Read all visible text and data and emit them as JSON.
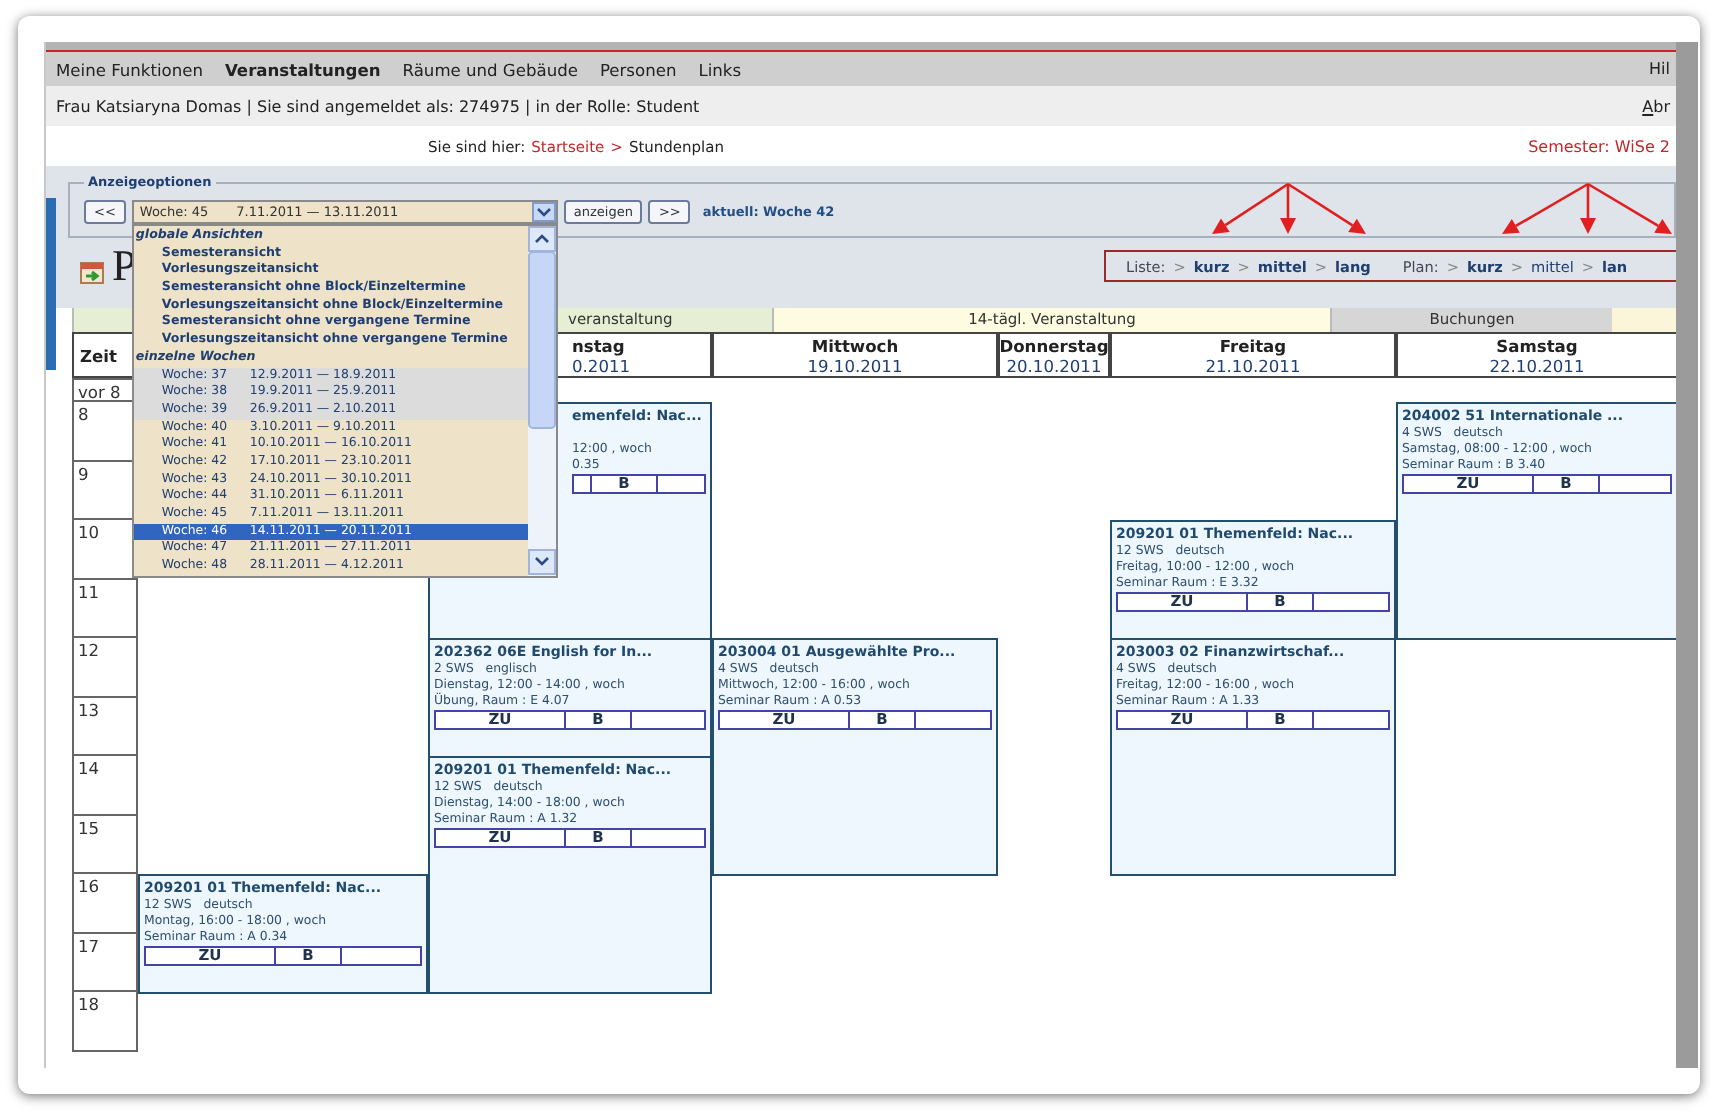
{
  "nav": {
    "items": [
      {
        "label": "Meine Funktionen",
        "selected": false
      },
      {
        "label": "Veranstaltungen",
        "selected": true
      },
      {
        "label": "Räume und Gebäude",
        "selected": false
      },
      {
        "label": "Personen",
        "selected": false
      },
      {
        "label": "Links",
        "selected": false
      }
    ],
    "help": "Hil"
  },
  "user_bar": {
    "text": "Frau Katsiaryna Domas | Sie sind angemeldet als: 274975 | in der Rolle: Student",
    "logout": "Abr"
  },
  "breadcrumb": {
    "prefix": "Sie sind hier:",
    "home": "Startseite",
    "separator": ">",
    "current": "Stundenplan",
    "semester": "Semester: WiSe 2"
  },
  "options": {
    "legend": "Anzeigeoptionen",
    "prev": "<<",
    "show": "anzeigen",
    "next": ">>",
    "current_week": "aktuell: Woche 42",
    "week_select": {
      "week": "Woche: 45",
      "dates": "7.11.2011 — 13.11.2011",
      "expanded": true,
      "groups": [
        {
          "kind": "views",
          "title": "globale Ansichten",
          "options": [
            {
              "label": "Semesteransicht"
            },
            {
              "label": "Vorlesungszeitansicht"
            },
            {
              "label": "Semesteransicht ohne Block/Einzeltermine"
            },
            {
              "label": "Vorlesungszeitansicht ohne Block/Einzeltermine"
            },
            {
              "label": "Semesteransicht ohne vergangene Termine"
            },
            {
              "label": "Vorlesungszeitansicht ohne vergangene Termine"
            }
          ]
        },
        {
          "kind": "weeks",
          "title": "einzelne Wochen",
          "options": [
            {
              "week": "Woche: 37",
              "dates": "12.9.2011 — 18.9.2011",
              "shaded": true,
              "selected": false
            },
            {
              "week": "Woche: 38",
              "dates": "19.9.2011 — 25.9.2011",
              "shaded": true,
              "selected": false
            },
            {
              "week": "Woche: 39",
              "dates": "26.9.2011 — 2.10.2011",
              "shaded": true,
              "selected": false
            },
            {
              "week": "Woche: 40",
              "dates": "3.10.2011 — 9.10.2011",
              "shaded": false,
              "selected": false
            },
            {
              "week": "Woche: 41",
              "dates": "10.10.2011 — 16.10.2011",
              "shaded": false,
              "selected": false
            },
            {
              "week": "Woche: 42",
              "dates": "17.10.2011 — 23.10.2011",
              "shaded": false,
              "selected": false
            },
            {
              "week": "Woche: 43",
              "dates": "24.10.2011 — 30.10.2011",
              "shaded": false,
              "selected": false
            },
            {
              "week": "Woche: 44",
              "dates": "31.10.2011 — 6.11.2011",
              "shaded": false,
              "selected": false
            },
            {
              "week": "Woche: 45",
              "dates": "7.11.2011 — 13.11.2011",
              "shaded": false,
              "selected": false
            },
            {
              "week": "Woche: 46",
              "dates": "14.11.2011 — 20.11.2011",
              "shaded": false,
              "selected": true
            },
            {
              "week": "Woche: 47",
              "dates": "21.11.2011 — 27.11.2011",
              "shaded": false,
              "selected": false
            },
            {
              "week": "Woche: 48",
              "dates": "28.11.2011 — 4.12.2011",
              "shaded": false,
              "selected": false
            }
          ]
        }
      ]
    }
  },
  "page_title": "P",
  "views": [
    {
      "label": "Liste:",
      "separator": ">",
      "links": [
        {
          "label": "kurz",
          "selected": false
        },
        {
          "label": "mittel",
          "selected": false
        },
        {
          "label": "lang",
          "selected": false
        }
      ]
    },
    {
      "label": "Plan:",
      "separator": ">",
      "links": [
        {
          "label": "kurz",
          "selected": false
        },
        {
          "label": "mittel",
          "selected": true
        },
        {
          "label": "lan",
          "selected": false
        }
      ]
    }
  ],
  "legend": [
    {
      "kind": "partial",
      "label": "veranstaltung",
      "color": "#e6eed4"
    },
    {
      "kind": "full",
      "label": "14-tägl. Veranstaltung",
      "color": "#fdfbe0"
    },
    {
      "kind": "full",
      "label": "Buchungen",
      "color": "#d6d6d6"
    }
  ],
  "timetable": {
    "time_header": "Zeit",
    "hours": [
      "vor 8",
      "8",
      "9",
      "10",
      "11",
      "12",
      "13",
      "14",
      "15",
      "16",
      "17",
      "18"
    ],
    "days": [
      {
        "kind": "covered",
        "events": [
          {
            "kind": "full",
            "title": "209201 01 Themenfeld: Nac...",
            "info": "12 SWS   deutsch",
            "when": {
              "weekday": "Montag,",
              "start": "16:00",
              "dash": "-",
              "end": "18:00",
              "rhythm": ", woch"
            },
            "room": "Seminar Raum : A 0.34",
            "actions": [
              "ZU",
              "B"
            ]
          }
        ]
      },
      {
        "kind": "partial",
        "name": "nstag",
        "date": "0.2011",
        "events": [
          {
            "kind": "partial",
            "title": "emenfeld: Nac...",
            "when": {
              "end": "12:00",
              "rhythm": ", woch"
            },
            "room": "0.35",
            "actions": [
              "B"
            ]
          },
          {
            "kind": "full",
            "title": "202362 06E English for In...",
            "info": "2 SWS   englisch",
            "when": {
              "weekday": "Dienstag,",
              "start": "12:00",
              "dash": "-",
              "end": "14:00",
              "rhythm": ", woch"
            },
            "room": "Übung, Raum : E 4.07",
            "actions": [
              "ZU",
              "B"
            ]
          },
          {
            "kind": "full",
            "title": "209201 01 Themenfeld: Nac...",
            "info": "12 SWS   deutsch",
            "when": {
              "weekday": "Dienstag,",
              "start": "14:00",
              "dash": "-",
              "end": "18:00",
              "rhythm": ", woch"
            },
            "room": "Seminar Raum : A 1.32",
            "actions": [
              "ZU",
              "B"
            ]
          }
        ]
      },
      {
        "kind": "full",
        "name": "Mittwoch",
        "date": "19.10.2011",
        "events": [
          {
            "kind": "full",
            "title": "203004 01 Ausgewählte Pro...",
            "info": "4 SWS   deutsch",
            "when": {
              "weekday": "Mittwoch,",
              "start": "12:00",
              "dash": "-",
              "end": "16:00",
              "rhythm": ", woch"
            },
            "room": "Seminar Raum : A 0.53",
            "actions": [
              "ZU",
              "B"
            ]
          }
        ]
      },
      {
        "kind": "full",
        "name": "Donnerstag",
        "date": "20.10.2011"
      },
      {
        "kind": "full",
        "name": "Freitag",
        "date": "21.10.2011",
        "events": [
          {
            "kind": "full",
            "title": "209201 01 Themenfeld: Nac...",
            "info": "12 SWS   deutsch",
            "when": {
              "weekday": "Freitag,",
              "start": "10:00",
              "dash": "-",
              "end": "12:00",
              "rhythm": ", woch"
            },
            "room": "Seminar Raum : E 3.32",
            "actions": [
              "ZU",
              "B"
            ]
          },
          {
            "kind": "full",
            "title": "203003 02 Finanzwirtschaf...",
            "info": "4 SWS   deutsch",
            "when": {
              "weekday": "Freitag,",
              "start": "12:00",
              "dash": "-",
              "end": "16:00",
              "rhythm": ", woch"
            },
            "room": "Seminar Raum : A 1.33",
            "actions": [
              "ZU",
              "B"
            ]
          }
        ]
      },
      {
        "kind": "full",
        "name": "Samstag",
        "date": "22.10.2011",
        "events": [
          {
            "kind": "full",
            "title": "204002 51 Internationale ...",
            "info": "4 SWS   deutsch",
            "when": {
              "weekday": "Samstag,",
              "start": "08:00",
              "dash": "-",
              "end": "12:00",
              "rhythm": ", woch"
            },
            "room": "Seminar Raum : B 3.40",
            "actions": [
              "ZU",
              "B"
            ]
          }
        ]
      }
    ]
  }
}
